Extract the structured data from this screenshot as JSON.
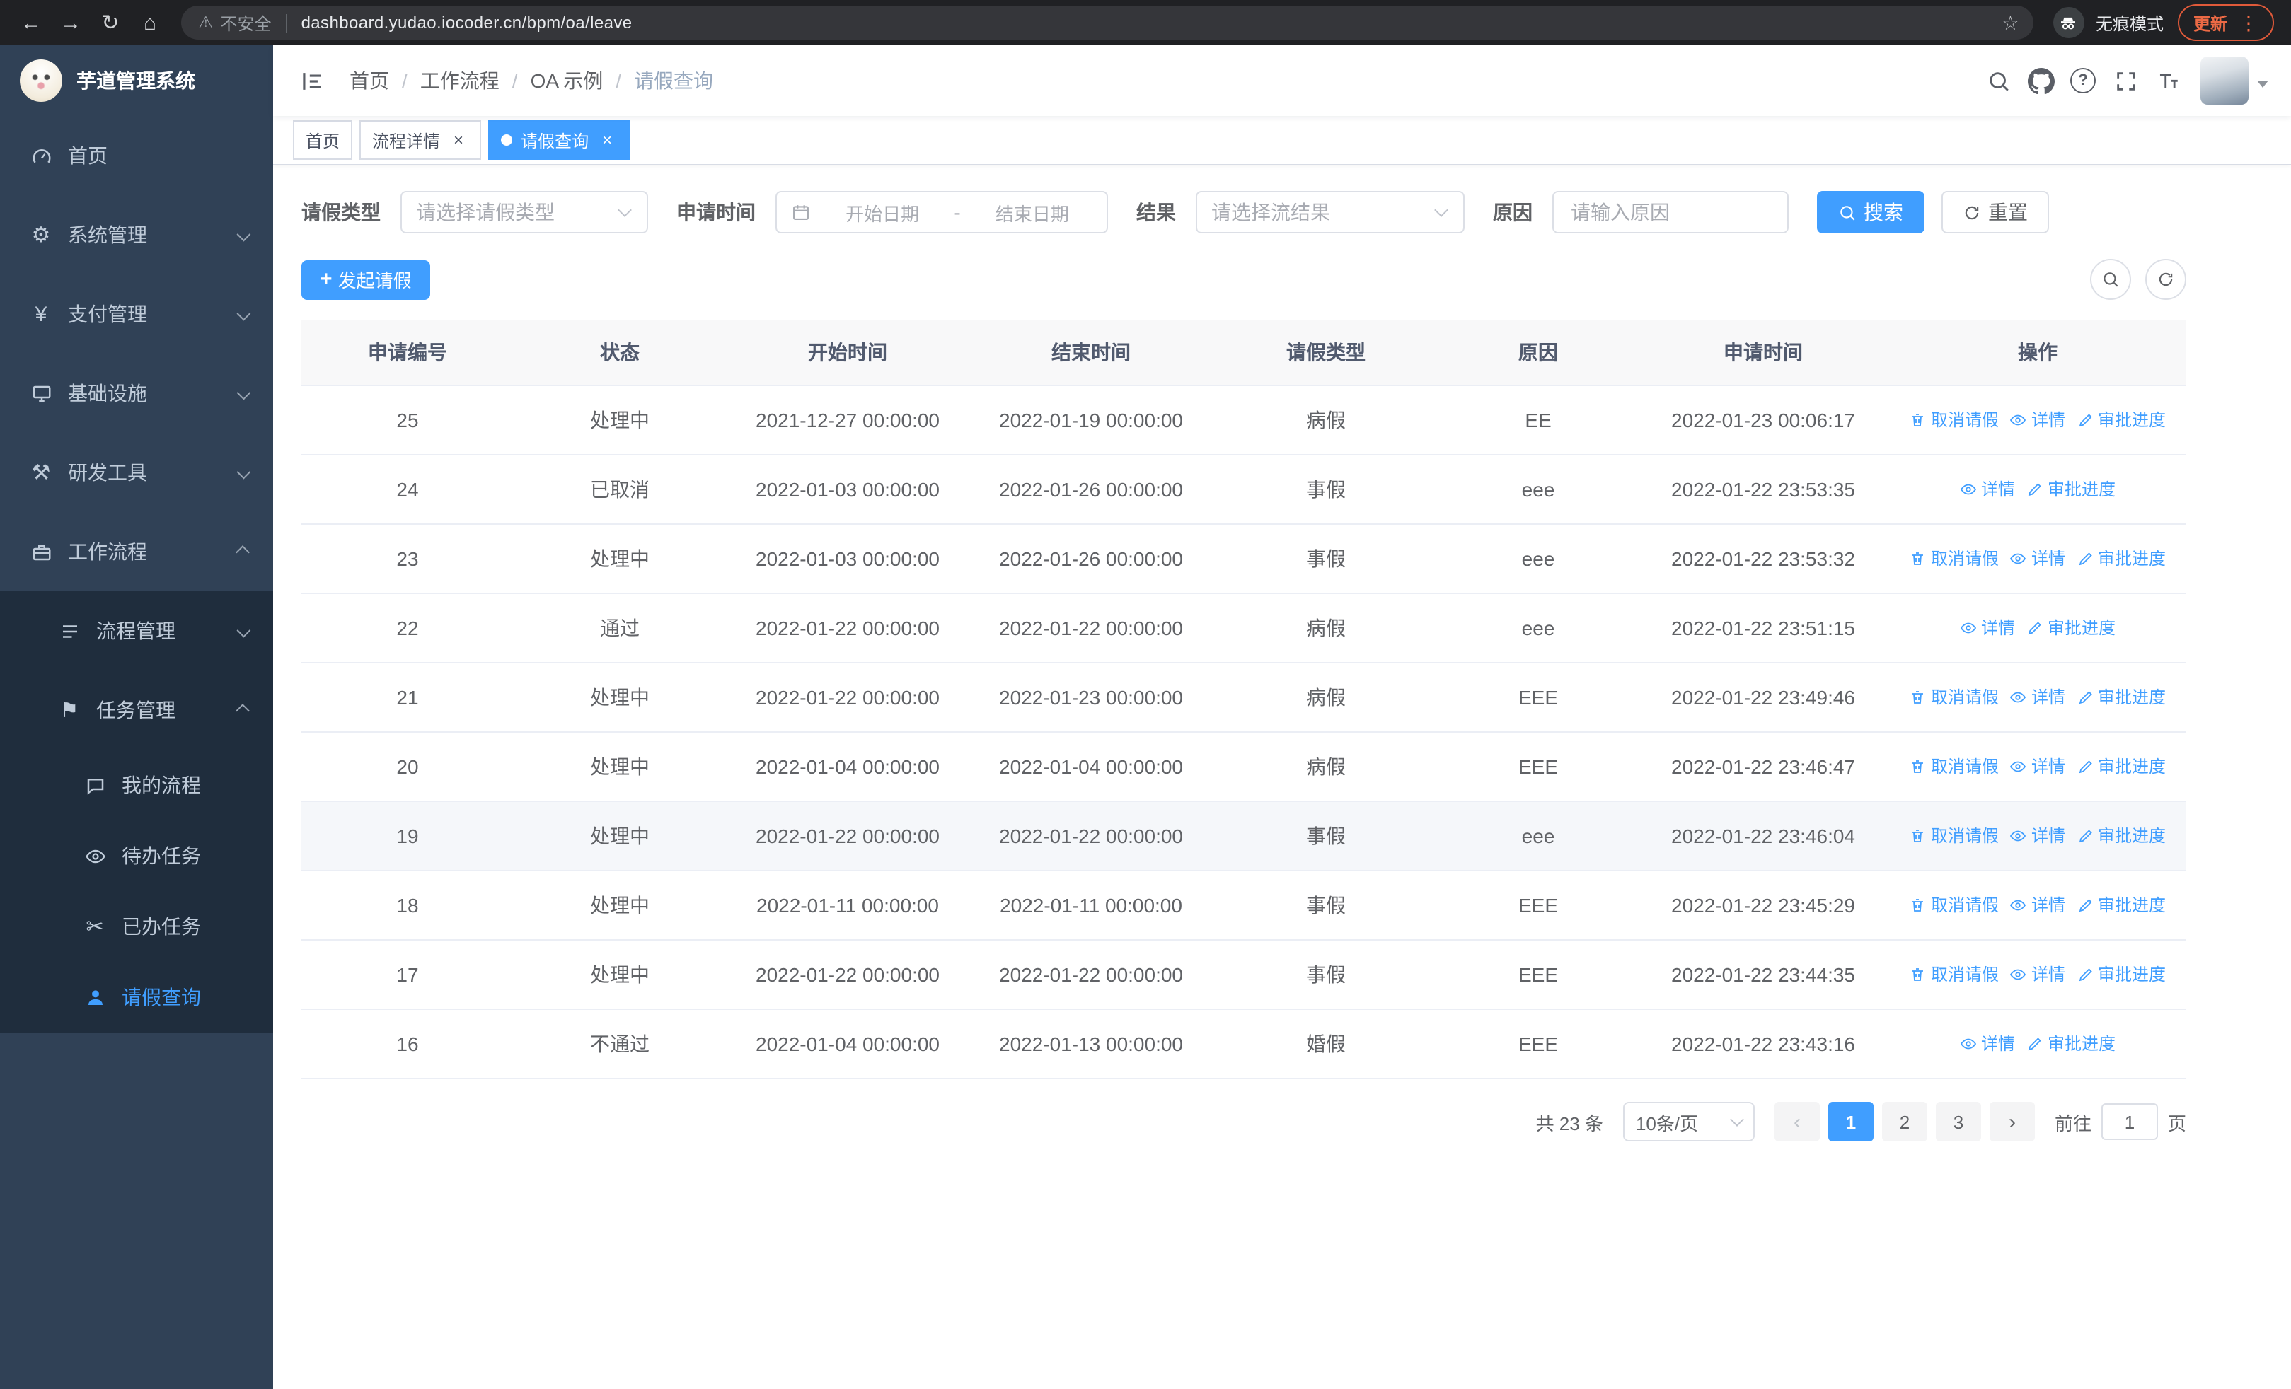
{
  "colors": {
    "primary": "#409eff",
    "sidebar_bg": "#304156",
    "sidebar_submenu_bg": "#1f2d3d",
    "active_tab_bg": "#409eff"
  },
  "browser": {
    "security_label": "不安全",
    "url": "dashboard.yudao.iocoder.cn/bpm/oa/leave",
    "incognito_label": "无痕模式",
    "update_label": "更新"
  },
  "sidebar": {
    "logo_title": "芋道管理系统",
    "items": [
      {
        "label": "首页",
        "icon": "dashboard-icon",
        "level": 1,
        "arrow": "",
        "active": false
      },
      {
        "label": "系统管理",
        "icon": "gear-icon",
        "level": 1,
        "arrow": "down",
        "active": false
      },
      {
        "label": "支付管理",
        "icon": "payment-icon",
        "level": 1,
        "arrow": "down",
        "active": false
      },
      {
        "label": "基础设施",
        "icon": "infrastructure-icon",
        "level": 1,
        "arrow": "down",
        "active": false
      },
      {
        "label": "研发工具",
        "icon": "tools-icon",
        "level": 1,
        "arrow": "down",
        "active": false
      },
      {
        "label": "工作流程",
        "icon": "briefcase-icon",
        "level": 1,
        "arrow": "up",
        "active": false
      },
      {
        "label": "流程管理",
        "icon": "list-icon",
        "level": 2,
        "arrow": "down",
        "active": false
      },
      {
        "label": "任务管理",
        "icon": "flag-icon",
        "level": 2,
        "arrow": "up",
        "active": false
      },
      {
        "label": "我的流程",
        "icon": "chat-icon",
        "level": 3,
        "arrow": "",
        "active": false
      },
      {
        "label": "待办任务",
        "icon": "eye-icon",
        "level": 3,
        "arrow": "",
        "active": false
      },
      {
        "label": "已办任务",
        "icon": "scissors-icon",
        "level": 3,
        "arrow": "",
        "active": false
      },
      {
        "label": "请假查询",
        "icon": "person-icon",
        "level": 3,
        "arrow": "",
        "active": true
      }
    ]
  },
  "header": {
    "breadcrumb": [
      "首页",
      "工作流程",
      "OA 示例",
      "请假查询"
    ],
    "separator": "/"
  },
  "tabs": [
    {
      "label": "首页",
      "closable": false,
      "active": false
    },
    {
      "label": "流程详情",
      "closable": true,
      "active": false
    },
    {
      "label": "请假查询",
      "closable": true,
      "active": true
    }
  ],
  "filters": {
    "leave_type_label": "请假类型",
    "leave_type_placeholder": "请选择请假类型",
    "apply_time_label": "申请时间",
    "start_placeholder": "开始日期",
    "range_separator": "-",
    "end_placeholder": "结束日期",
    "result_label": "结果",
    "result_placeholder": "请选择流结果",
    "reason_label": "原因",
    "reason_placeholder": "请输入原因",
    "search_label": "搜索",
    "reset_label": "重置"
  },
  "toolbar": {
    "create_label": "发起请假"
  },
  "table": {
    "columns": [
      "申请编号",
      "状态",
      "开始时间",
      "结束时间",
      "请假类型",
      "原因",
      "申请时间",
      "操作"
    ],
    "action_labels": {
      "cancel": "取消请假",
      "detail": "详情",
      "progress": "审批进度"
    },
    "rows": [
      {
        "id": "25",
        "status": "处理中",
        "start": "2021-12-27 00:00:00",
        "end": "2022-01-19 00:00:00",
        "type": "病假",
        "reason": "EE",
        "applied": "2022-01-23 00:06:17",
        "actions": [
          "cancel",
          "detail",
          "progress"
        ],
        "highlighted": false
      },
      {
        "id": "24",
        "status": "已取消",
        "start": "2022-01-03 00:00:00",
        "end": "2022-01-26 00:00:00",
        "type": "事假",
        "reason": "eee",
        "applied": "2022-01-22 23:53:35",
        "actions": [
          "detail",
          "progress"
        ],
        "highlighted": false
      },
      {
        "id": "23",
        "status": "处理中",
        "start": "2022-01-03 00:00:00",
        "end": "2022-01-26 00:00:00",
        "type": "事假",
        "reason": "eee",
        "applied": "2022-01-22 23:53:32",
        "actions": [
          "cancel",
          "detail",
          "progress"
        ],
        "highlighted": false
      },
      {
        "id": "22",
        "status": "通过",
        "start": "2022-01-22 00:00:00",
        "end": "2022-01-22 00:00:00",
        "type": "病假",
        "reason": "eee",
        "applied": "2022-01-22 23:51:15",
        "actions": [
          "detail",
          "progress"
        ],
        "highlighted": false
      },
      {
        "id": "21",
        "status": "处理中",
        "start": "2022-01-22 00:00:00",
        "end": "2022-01-23 00:00:00",
        "type": "病假",
        "reason": "EEE",
        "applied": "2022-01-22 23:49:46",
        "actions": [
          "cancel",
          "detail",
          "progress"
        ],
        "highlighted": false
      },
      {
        "id": "20",
        "status": "处理中",
        "start": "2022-01-04 00:00:00",
        "end": "2022-01-04 00:00:00",
        "type": "病假",
        "reason": "EEE",
        "applied": "2022-01-22 23:46:47",
        "actions": [
          "cancel",
          "detail",
          "progress"
        ],
        "highlighted": false
      },
      {
        "id": "19",
        "status": "处理中",
        "start": "2022-01-22 00:00:00",
        "end": "2022-01-22 00:00:00",
        "type": "事假",
        "reason": "eee",
        "applied": "2022-01-22 23:46:04",
        "actions": [
          "cancel",
          "detail",
          "progress"
        ],
        "highlighted": true
      },
      {
        "id": "18",
        "status": "处理中",
        "start": "2022-01-11 00:00:00",
        "end": "2022-01-11 00:00:00",
        "type": "事假",
        "reason": "EEE",
        "applied": "2022-01-22 23:45:29",
        "actions": [
          "cancel",
          "detail",
          "progress"
        ],
        "highlighted": false
      },
      {
        "id": "17",
        "status": "处理中",
        "start": "2022-01-22 00:00:00",
        "end": "2022-01-22 00:00:00",
        "type": "事假",
        "reason": "EEE",
        "applied": "2022-01-22 23:44:35",
        "actions": [
          "cancel",
          "detail",
          "progress"
        ],
        "highlighted": false
      },
      {
        "id": "16",
        "status": "不通过",
        "start": "2022-01-04 00:00:00",
        "end": "2022-01-13 00:00:00",
        "type": "婚假",
        "reason": "EEE",
        "applied": "2022-01-22 23:43:16",
        "actions": [
          "detail",
          "progress"
        ],
        "highlighted": false
      }
    ]
  },
  "pagination": {
    "total_label": "共 23 条",
    "page_size_value": "10条/页",
    "pages": [
      "1",
      "2",
      "3"
    ],
    "active_page": "1",
    "goto_label": "前往",
    "goto_value": "1",
    "page_unit_label": "页"
  }
}
